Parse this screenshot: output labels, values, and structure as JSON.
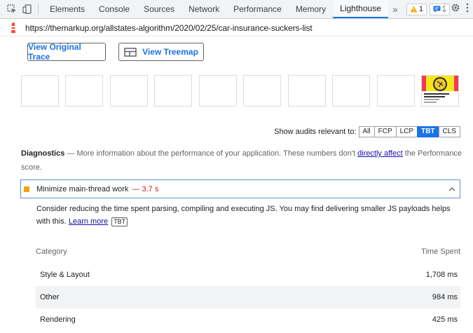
{
  "devtools": {
    "tabs": [
      "Elements",
      "Console",
      "Sources",
      "Network",
      "Performance",
      "Memory",
      "Lighthouse"
    ],
    "active_tab": "Lighthouse",
    "more_tabs": "»",
    "warnings_count": "1",
    "messages_count": "1"
  },
  "url": "https://themarkup.org/allstates-algorithm/2020/02/25/car-insurance-suckers-list",
  "buttons": {
    "view_trace": "View Original Trace",
    "view_treemap": "View Treemap"
  },
  "filter": {
    "label": "Show audits relevant to:",
    "options": [
      "All",
      "FCP",
      "LCP",
      "TBT",
      "CLS"
    ],
    "active": "TBT"
  },
  "diagnostics": {
    "title": "Diagnostics",
    "dash": "—",
    "text": "More information about the performance of your application. These numbers don't",
    "link": "directly affect",
    "text2": "the Performance score."
  },
  "audit": {
    "title": "Minimize main-thread work",
    "value": "— 3.7 s",
    "description": "Consider reducing the time spent parsing, compiling and executing JS. You may find delivering smaller JS payloads helps with this.",
    "learn_more": "Learn more",
    "tag": "TBT"
  },
  "table": {
    "headers": [
      "Category",
      "Time Spent"
    ],
    "rows": [
      {
        "category": "Style & Layout",
        "time": "1,708 ms"
      },
      {
        "category": "Other",
        "time": "984 ms"
      },
      {
        "category": "Rendering",
        "time": "425 ms"
      }
    ]
  },
  "colors": {
    "accent": "#1a73e8",
    "warning": "#f3a30b",
    "value_red": "#c5221f"
  },
  "icons": [
    "inspect-icon",
    "device-toolbar-icon",
    "warning-icon",
    "message-icon",
    "settings-gear-icon",
    "more-vert-icon",
    "lighthouse-icon",
    "treemap-icon",
    "chevron-up-icon"
  ]
}
